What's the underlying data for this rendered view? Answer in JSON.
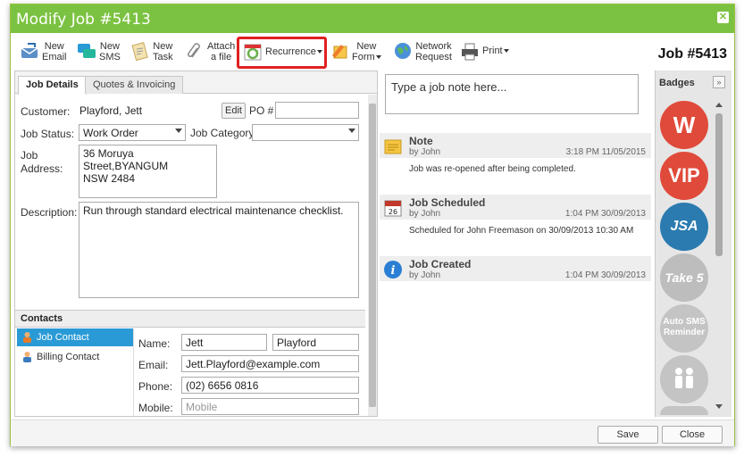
{
  "window": {
    "title": "Modify Job #5413",
    "job_number": "Job #5413"
  },
  "toolbar": {
    "new_email": [
      "New",
      "Email"
    ],
    "new_sms": [
      "New",
      "SMS"
    ],
    "new_task": [
      "New",
      "Task"
    ],
    "attach_file": [
      "Attach",
      "a file"
    ],
    "recurrence": "Recurrence",
    "new_form": [
      "New",
      "Form"
    ],
    "network_request": [
      "Network",
      "Request"
    ],
    "print": "Print"
  },
  "tabs": [
    "Job Details",
    "Quotes & Invoicing"
  ],
  "job": {
    "customer_label": "Customer:",
    "customer": "Playford, Jett",
    "edit_label": "Edit",
    "po_label": "PO #",
    "po_value": "",
    "status_label": "Job Status:",
    "status": "Work Order",
    "category_label": "Job Category",
    "category": "",
    "address_label_1": "Job",
    "address_label_2": "Address:",
    "address_1": "36 Moruya Street,BYANGUM",
    "address_2": "NSW 2484",
    "description_label": "Description:",
    "description": "Run through standard electrical maintenance checklist."
  },
  "contacts": {
    "header": "Contacts",
    "items": [
      "Job Contact",
      "Billing Contact"
    ],
    "name_label": "Name:",
    "first_name": "Jett",
    "last_name": "Playford",
    "email_label": "Email:",
    "email": "Jett.Playford@example.com",
    "phone_label": "Phone:",
    "phone": "(02) 6656 0816",
    "mobile_label": "Mobile:",
    "mobile_placeholder": "Mobile"
  },
  "notes": {
    "placeholder": "Type a job note here...",
    "entries": [
      {
        "title": "Note",
        "by": "by John",
        "time": "3:18 PM 11/05/2015",
        "body": "Job was re-opened after being completed.",
        "icon": "note-icon"
      },
      {
        "title": "Job Scheduled",
        "by": "by John",
        "time": "1:04 PM 30/09/2013",
        "body": "Scheduled for John Freemason on 30/09/2013 10:30 AM",
        "icon": "calendar-icon"
      },
      {
        "title": "Job Created",
        "by": "by John",
        "time": "1:04 PM 30/09/2013",
        "body": "",
        "icon": "info-icon"
      }
    ]
  },
  "badges": {
    "header": "Badges",
    "items": [
      {
        "label": "W",
        "color": "#e04a3a"
      },
      {
        "label": "VIP",
        "color": "#e04a3a"
      },
      {
        "label": "JSA",
        "color": "#2b7bb0"
      },
      {
        "label": "Take 5",
        "color": "#bdbdbd"
      },
      {
        "label_1": "Auto SMS",
        "label_2": "Reminder",
        "color": "#c4c4c4"
      },
      {
        "label": "",
        "color": "#c4c4c4"
      }
    ]
  },
  "footer": {
    "save": "Save",
    "close": "Close"
  },
  "colors": {
    "titlebar": "#7cc242",
    "highlight": "#e02020",
    "contact_active": "#2a9ad6"
  }
}
